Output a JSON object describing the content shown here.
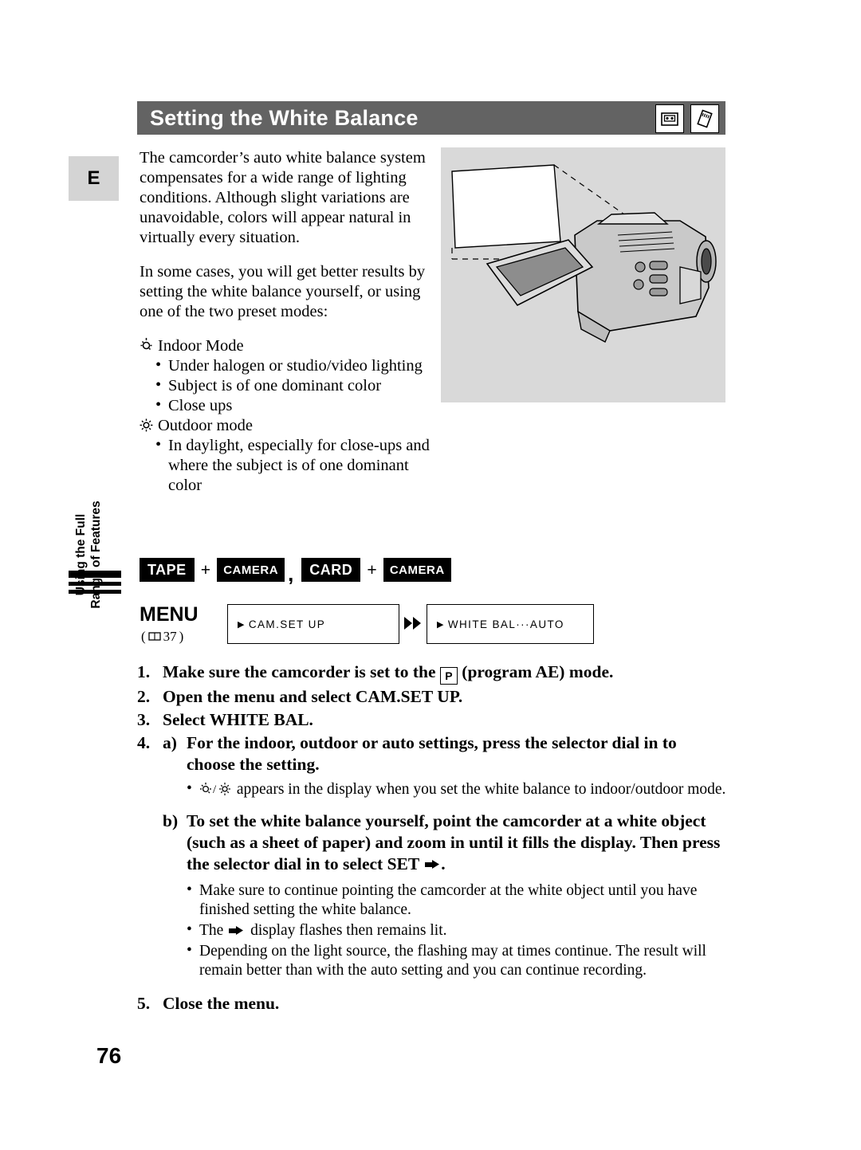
{
  "header": {
    "title": "Setting the White Balance",
    "icons": [
      "tape-cassette-icon",
      "memory-card-icon"
    ]
  },
  "language_badge": "E",
  "intro": {
    "paragraph1": "The camcorder’s auto white balance system compensates for a wide range of lighting conditions. Although slight variations are unavoidable, colors will appear natural in virtually every situation.",
    "paragraph2": "In some cases, you will get better results by setting the white balance yourself, or using one of the two preset modes:"
  },
  "modes": [
    {
      "icon": "indoor-lamp-icon",
      "label": "Indoor Mode",
      "bullets": [
        "Under halogen or studio/video lighting",
        "Subject is of one dominant color",
        "Close ups"
      ]
    },
    {
      "icon": "outdoor-sun-icon",
      "label": "Outdoor mode",
      "bullets": [
        "In daylight, especially for close-ups and where the subject is of one dominant color"
      ]
    }
  ],
  "side_tab": {
    "line1": "Using the Full",
    "line2": "Range of Features"
  },
  "mode_keys": {
    "group1": [
      "TAPE",
      "CAMERA"
    ],
    "separator": ",",
    "group2": [
      "CARD",
      "CAMERA"
    ],
    "plus": "+"
  },
  "menu": {
    "label": "MENU",
    "reference": "37",
    "reference_open": "(",
    "reference_close": ")",
    "box1": "CAM.SET UP",
    "box2": "WHITE BAL···AUTO",
    "marker": "▶"
  },
  "steps": [
    {
      "num": "1.",
      "text_pre": "Make sure the camcorder is set to the ",
      "text_post": " (program AE) mode.",
      "icon": "program-ae-p-icon"
    },
    {
      "num": "2.",
      "text": "Open the menu and select CAM.SET UP."
    },
    {
      "num": "3.",
      "text": "Select WHITE BAL."
    },
    {
      "num": "4.",
      "text": ""
    },
    {
      "num": "5.",
      "text": "Close the menu."
    }
  ],
  "step4": {
    "a_label": "a)",
    "a_text": "For the indoor, outdoor or auto settings, press the selector dial in to choose the setting.",
    "a_note_pre": "",
    "a_note": "appears in the display when you set the white balance to indoor/outdoor mode.",
    "a_note_icons": "indoor-icon / outdoor-icon",
    "b_label": "b)",
    "b_text_pre": "To set the white balance yourself, point the camcorder at a white object (such as a sheet of paper) and zoom in until it fills the display. Then press the selector dial in to select SET",
    "b_text_post": ".",
    "b_notes": [
      "Make sure to continue pointing the camcorder at the white object until you have finished setting the white balance.",
      "display flashes then remains lit.",
      "Depending on the light source, the flashing may at times continue. The result will remain better than with the auto setting and you can continue recording."
    ],
    "b_note2_pre": "The"
  },
  "page_number": "76",
  "colors": {
    "title_bar": "#636363",
    "badge_bg": "#d4d4d4",
    "illustration_bg": "#d9d9d9"
  }
}
